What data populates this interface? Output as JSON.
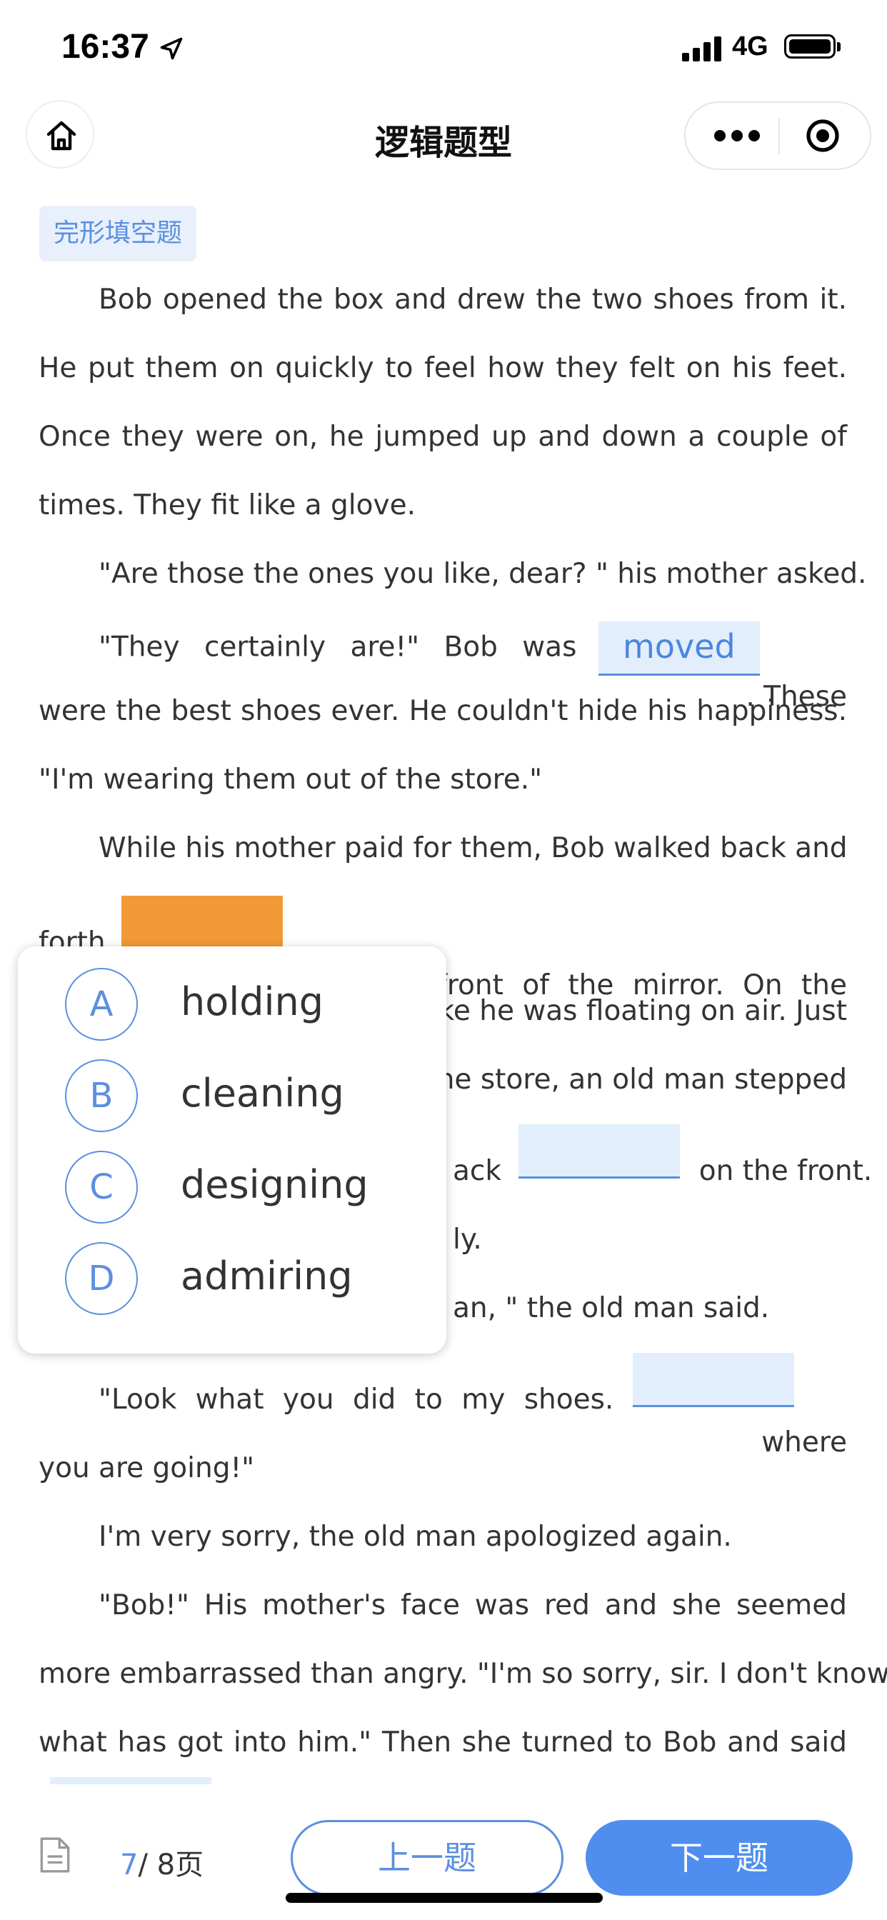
{
  "status_bar": {
    "time": "16:37",
    "network": "4G"
  },
  "nav": {
    "title": "逻辑题型"
  },
  "question_type": "完形填空题",
  "passage": {
    "lines": [
      "Bob opened the box and drew the two shoes from it.",
      "He put them on quickly to feel how they felt on his feet.",
      "Once they were on, he jumped up and down a couple of",
      "times. They fit like a glove.",
      "\"Are those the ones you like, dear? \" his mother asked.",
      "\"They certainly are!\" Bob was",
      ". These",
      "were the best shoes ever. He couldn't hide his happiness.",
      "\"I'm wearing them out of the store.\"",
      "While his mother paid for them, Bob walked back and",
      "forth",
      "his shoes in front of the mirror. On the",
      "ike he was floating on air. Just",
      "ne store, an old man stepped",
      "ack",
      "on the front.",
      "ly.",
      "an, \" the old man said.",
      "\"Look what you did to my shoes.",
      "where",
      "you are going!\"",
      "I'm very sorry, the old man apologized again.",
      "\"Bob!\" His mother's face was red and she seemed",
      "more embarrassed than angry. \"I'm so sorry, sir. I don't know",
      "what has got into him.\" Then she turned to Bob and said"
    ],
    "filled_answer": "moved"
  },
  "options": [
    {
      "letter": "A",
      "text": "holding"
    },
    {
      "letter": "B",
      "text": "cleaning"
    },
    {
      "letter": "C",
      "text": "designing"
    },
    {
      "letter": "D",
      "text": "admiring"
    }
  ],
  "footer": {
    "current_page": "7",
    "total_pages": "/ 8页",
    "prev_label": "上一题",
    "next_label": "下一题"
  },
  "colors": {
    "accent": "#5b8fe0",
    "active_blank": "#f19a37",
    "blank_bg": "#e2eefb",
    "next_button": "#4f8eef"
  }
}
